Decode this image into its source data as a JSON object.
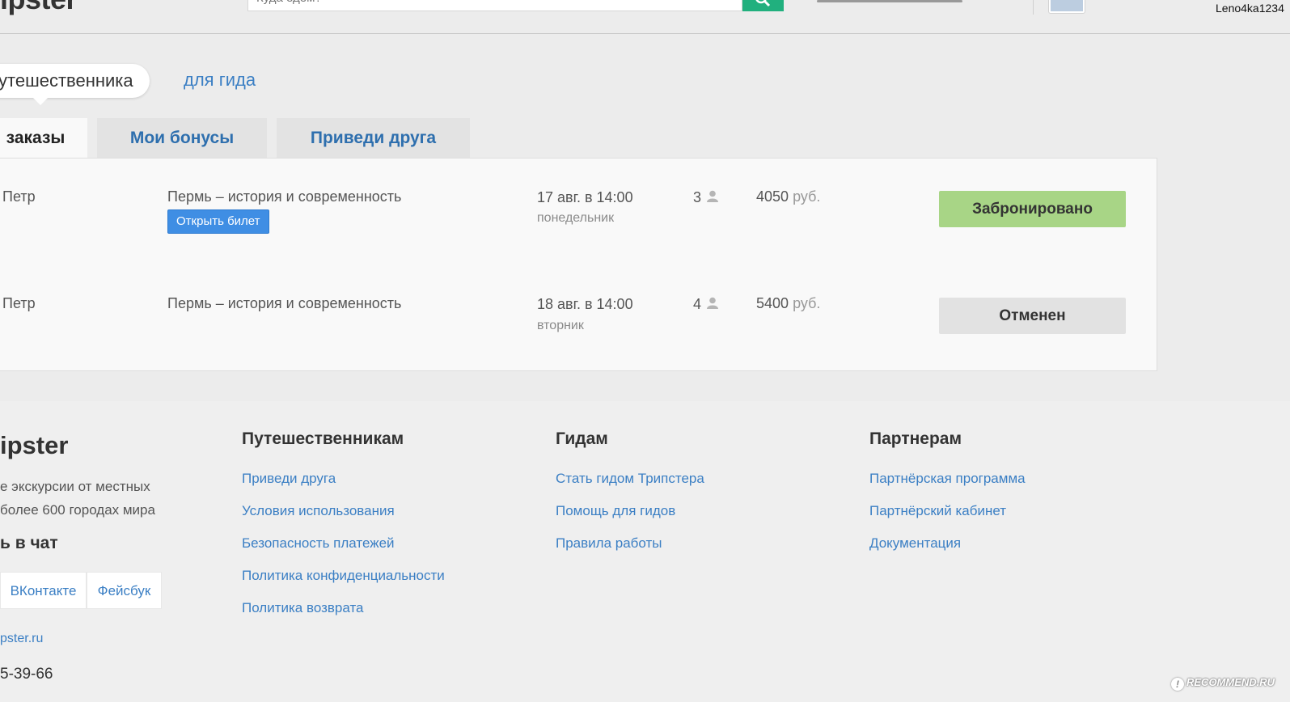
{
  "header": {
    "logo": "ipster",
    "search_placeholder": "Куда едем?",
    "username": "Leno4ka1234"
  },
  "role_switch": {
    "traveler": "утешественника",
    "guide": "для гида"
  },
  "tabs": [
    {
      "label": "заказы",
      "active": true
    },
    {
      "label": "Мои бонусы",
      "active": false
    },
    {
      "label": "Приведи друга",
      "active": false
    }
  ],
  "orders": [
    {
      "guide": "Петр",
      "tour": "Пермь – история и современность",
      "ticket_button": "Открыть билет",
      "date": "17 авг. в 14:00",
      "weekday": "понедельник",
      "persons": "3",
      "price": "4050",
      "currency": "руб.",
      "status": "Забронировано"
    },
    {
      "guide": "Петр",
      "tour": "Пермь – история и современность",
      "date": "18 авг. в 14:00",
      "weekday": "вторник",
      "persons": "4",
      "price": "5400",
      "currency": "руб.",
      "status": "Отменен"
    }
  ],
  "footer": {
    "logo": "ipster",
    "tagline_1": "е экскурсии от местных",
    "tagline_2": "более 600 городах мира",
    "chat_title": "ь в чат",
    "social": [
      "ВКонтакте",
      "Фейсбук"
    ],
    "site": "pster.ru",
    "phone": "5-39-66",
    "columns": [
      {
        "title": "Путешественникам",
        "links": [
          "Приведи друга",
          "Условия использования",
          "Безопасность платежей",
          "Политика конфиденциальности",
          "Политика возврата"
        ]
      },
      {
        "title": "Гидам",
        "links": [
          "Стать гидом Трипстера",
          "Помощь для гидов",
          "Правила работы"
        ]
      },
      {
        "title": "Партнерам",
        "links": [
          "Партнёрская программа",
          "Партнёрский кабинет",
          "Документация"
        ]
      }
    ]
  },
  "watermark": "RECOMMEND.RU",
  "colors": {
    "accent_green": "#21b07e",
    "link_blue": "#3b7fc4",
    "booked_green": "#a8d586",
    "ticket_blue": "#3f8ee4"
  }
}
